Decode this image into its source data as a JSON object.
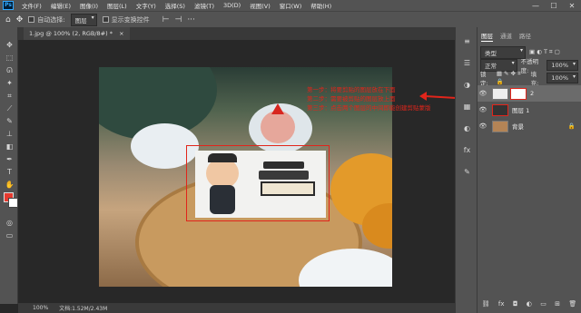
{
  "menubar": {
    "logo": "Ps",
    "items": [
      "文件(F)",
      "编辑(E)",
      "图像(I)",
      "图层(L)",
      "文字(Y)",
      "选择(S)",
      "滤镜(T)",
      "3D(D)",
      "视图(V)",
      "窗口(W)",
      "帮助(H)"
    ],
    "minimize": "—",
    "maximize": "☐",
    "close": "✕"
  },
  "options": {
    "auto_select_label": "自动选择:",
    "auto_select_value": "图层",
    "transform_label": "显示变换控件"
  },
  "document": {
    "tab_title": "1.jpg @ 100% (2, RGB/8#) *",
    "tab_close": "×"
  },
  "annotation": {
    "lines": [
      "第一步：将要剪贴的图层放在下面",
      "第二步：需要被剪贴的图层放上面",
      "第三步：点击两个图层的中间即能创建剪贴蒙版"
    ]
  },
  "status": {
    "zoom": "100%",
    "doc_info": "文档:1.52M/2.43M"
  },
  "layers_panel": {
    "tabs": [
      "图层",
      "通道",
      "路径"
    ],
    "filter_label": "类型",
    "blend_mode": "正常",
    "opacity_label": "不透明度:",
    "opacity_value": "100%",
    "lock_label": "锁定:",
    "fill_label": "填充:",
    "fill_value": "100%",
    "layers": [
      {
        "name": "2"
      },
      {
        "name": "图层 1"
      },
      {
        "name": "背景"
      }
    ],
    "footer_icons": [
      "link-icon",
      "fx-icon",
      "mask-icon",
      "adjustment-icon",
      "folder-icon",
      "new-layer-icon",
      "trash-icon"
    ]
  },
  "colors": {
    "annotation_red": "#e1251b",
    "foreground": "#e53a2f",
    "background": "#ffffff",
    "ps_blue": "#31a8ff"
  }
}
